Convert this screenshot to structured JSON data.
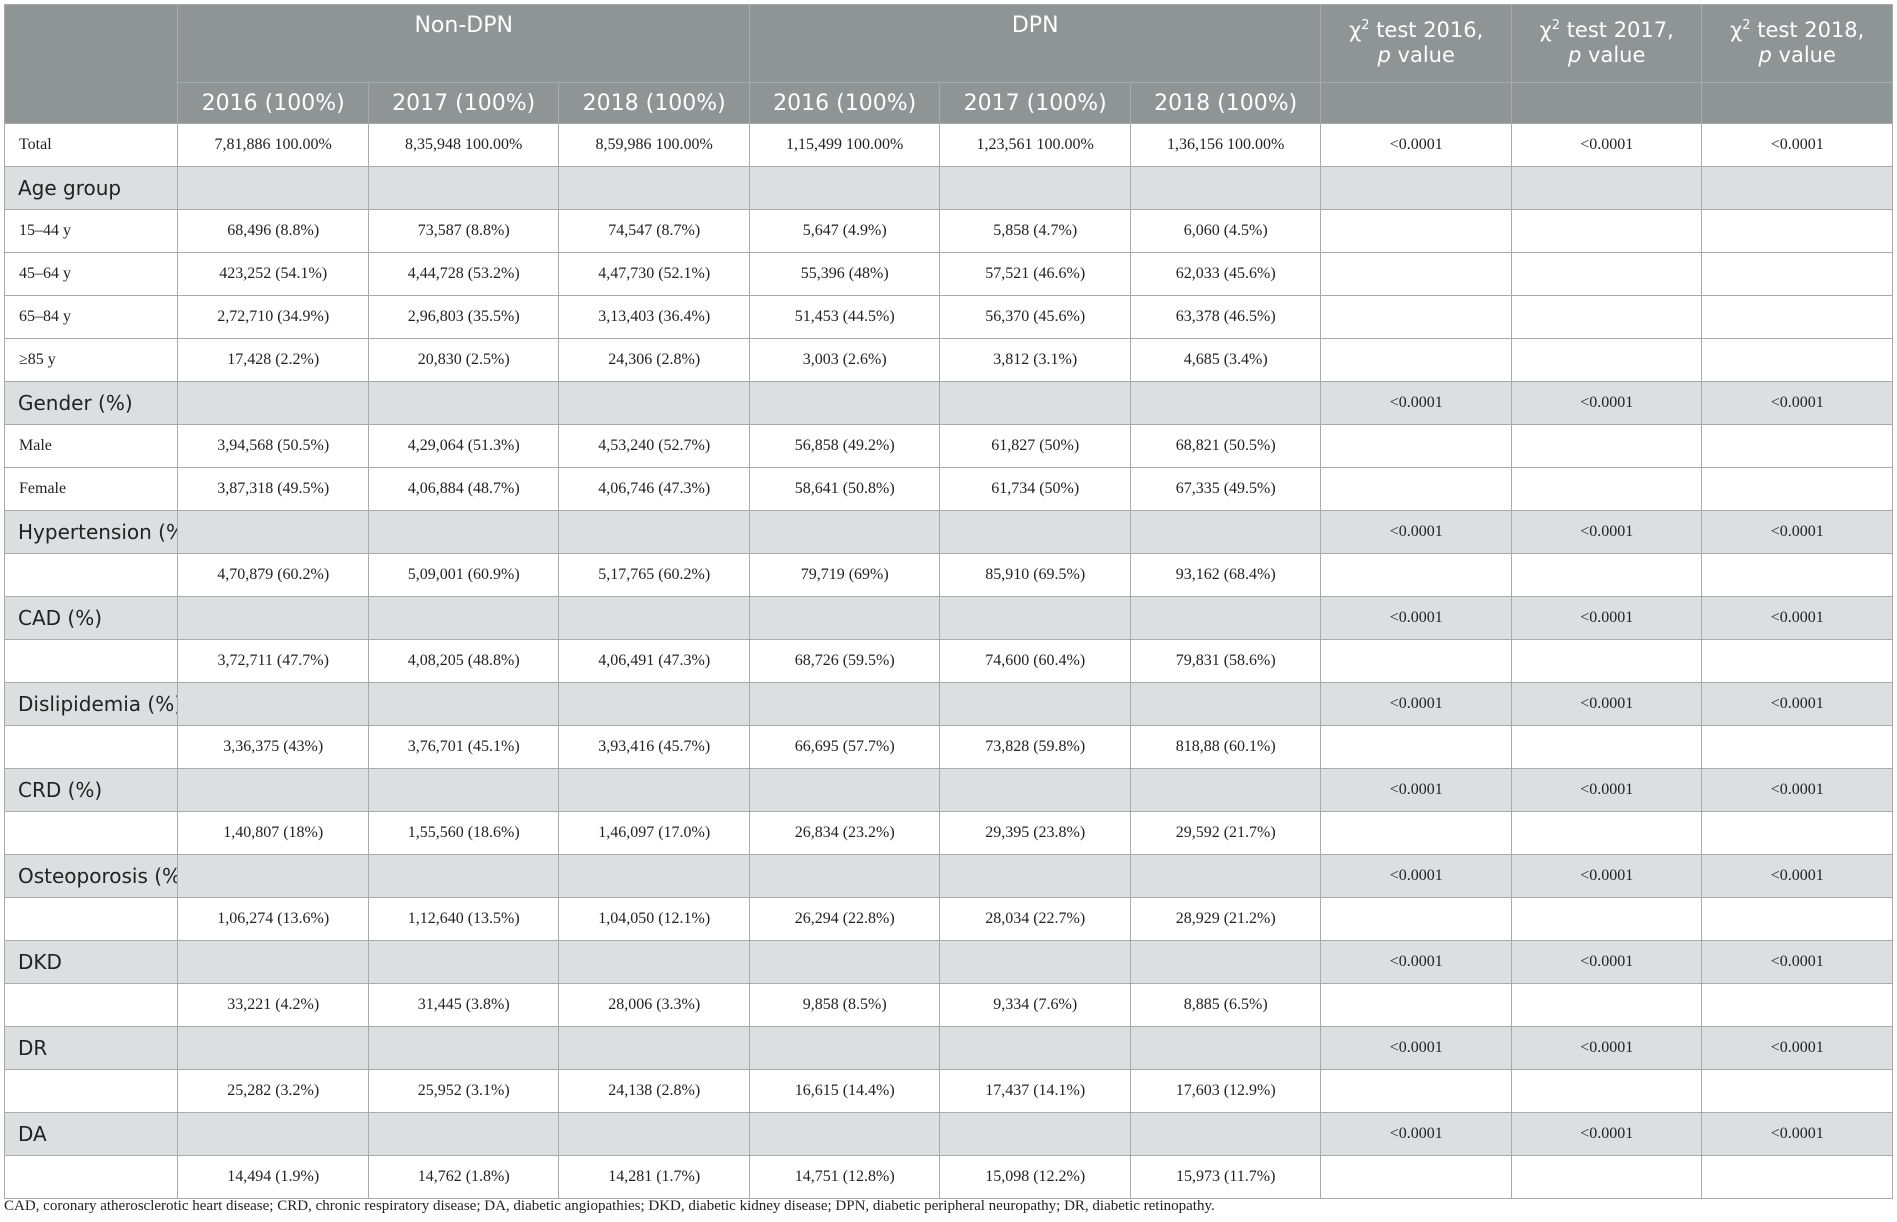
{
  "header": {
    "group_non_dpn": "Non-DPN",
    "group_dpn": "DPN",
    "chi_symbol": "χ",
    "chi_sup": "2",
    "pval_2016_a": "test 2016,",
    "pval_2017_a": "test 2017,",
    "pval_2018_a": "test 2018,",
    "pval_p": "p",
    "pval_value": "value",
    "years": [
      "2016 (100%)",
      "2017 (100%)",
      "2018 (100%)",
      "2016 (100%)",
      "2017 (100%)",
      "2018 (100%)"
    ]
  },
  "rows": [
    {
      "type": "data",
      "label": "Total",
      "cells": [
        "7,81,886 100.00%",
        "8,35,948 100.00%",
        "8,59,986 100.00%",
        "1,15,499 100.00%",
        "1,23,561 100.00%",
        "1,36,156 100.00%"
      ],
      "p": [
        "<0.0001",
        "<0.0001",
        "<0.0001"
      ]
    },
    {
      "type": "section",
      "label": "Age group",
      "p": [
        "",
        "",
        ""
      ]
    },
    {
      "type": "data",
      "label": "15–44 y",
      "cells": [
        "68,496 (8.8%)",
        "73,587 (8.8%)",
        "74,547 (8.7%)",
        "5,647 (4.9%)",
        "5,858 (4.7%)",
        "6,060 (4.5%)"
      ],
      "p": [
        "",
        "",
        ""
      ]
    },
    {
      "type": "data",
      "label": "45–64 y",
      "cells": [
        "423,252 (54.1%)",
        "4,44,728 (53.2%)",
        "4,47,730 (52.1%)",
        "55,396 (48%)",
        "57,521 (46.6%)",
        "62,033 (45.6%)"
      ],
      "p": [
        "",
        "",
        ""
      ]
    },
    {
      "type": "data",
      "label": "65–84 y",
      "cells": [
        "2,72,710 (34.9%)",
        "2,96,803 (35.5%)",
        "3,13,403 (36.4%)",
        "51,453 (44.5%)",
        "56,370 (45.6%)",
        "63,378 (46.5%)"
      ],
      "p": [
        "",
        "",
        ""
      ]
    },
    {
      "type": "data",
      "label": "≥85 y",
      "cells": [
        "17,428 (2.2%)",
        "20,830 (2.5%)",
        "24,306 (2.8%)",
        "3,003 (2.6%)",
        "3,812 (3.1%)",
        "4,685 (3.4%)"
      ],
      "p": [
        "",
        "",
        ""
      ]
    },
    {
      "type": "section",
      "label": "Gender (%)",
      "p": [
        "<0.0001",
        "<0.0001",
        "<0.0001"
      ]
    },
    {
      "type": "data",
      "label": "Male",
      "cells": [
        "3,94,568 (50.5%)",
        "4,29,064 (51.3%)",
        "4,53,240 (52.7%)",
        "56,858 (49.2%)",
        "61,827 (50%)",
        "68,821 (50.5%)"
      ],
      "p": [
        "",
        "",
        ""
      ]
    },
    {
      "type": "data",
      "label": "Female",
      "cells": [
        "3,87,318 (49.5%)",
        "4,06,884 (48.7%)",
        "4,06,746 (47.3%)",
        "58,641 (50.8%)",
        "61,734 (50%)",
        "67,335 (49.5%)"
      ],
      "p": [
        "",
        "",
        ""
      ]
    },
    {
      "type": "section",
      "label": "Hypertension (%)",
      "p": [
        "<0.0001",
        "<0.0001",
        "<0.0001"
      ]
    },
    {
      "type": "data",
      "label": "",
      "cells": [
        "4,70,879 (60.2%)",
        "5,09,001 (60.9%)",
        "5,17,765 (60.2%)",
        "79,719 (69%)",
        "85,910 (69.5%)",
        "93,162 (68.4%)"
      ],
      "p": [
        "",
        "",
        ""
      ]
    },
    {
      "type": "section",
      "label": "CAD (%)",
      "p": [
        "<0.0001",
        "<0.0001",
        "<0.0001"
      ]
    },
    {
      "type": "data",
      "label": "",
      "cells": [
        "3,72,711 (47.7%)",
        "4,08,205 (48.8%)",
        "4,06,491 (47.3%)",
        "68,726 (59.5%)",
        "74,600 (60.4%)",
        "79,831 (58.6%)"
      ],
      "p": [
        "",
        "",
        ""
      ]
    },
    {
      "type": "section",
      "label": "Dislipidemia (%)",
      "p": [
        "<0.0001",
        "<0.0001",
        "<0.0001"
      ]
    },
    {
      "type": "data",
      "label": "",
      "cells": [
        "3,36,375 (43%)",
        "3,76,701 (45.1%)",
        "3,93,416 (45.7%)",
        "66,695 (57.7%)",
        "73,828 (59.8%)",
        "818,88 (60.1%)"
      ],
      "p": [
        "",
        "",
        ""
      ]
    },
    {
      "type": "section",
      "label": "CRD (%)",
      "p": [
        "<0.0001",
        "<0.0001",
        "<0.0001"
      ]
    },
    {
      "type": "data",
      "label": "",
      "cells": [
        "1,40,807 (18%)",
        "1,55,560 (18.6%)",
        "1,46,097 (17.0%)",
        "26,834 (23.2%)",
        "29,395 (23.8%)",
        "29,592 (21.7%)"
      ],
      "p": [
        "",
        "",
        ""
      ]
    },
    {
      "type": "section",
      "label": "Osteoporosis (%)",
      "p": [
        "<0.0001",
        "<0.0001",
        "<0.0001"
      ]
    },
    {
      "type": "data",
      "label": "",
      "cells": [
        "1,06,274 (13.6%)",
        "1,12,640 (13.5%)",
        "1,04,050 (12.1%)",
        "26,294 (22.8%)",
        "28,034 (22.7%)",
        "28,929 (21.2%)"
      ],
      "p": [
        "",
        "",
        ""
      ]
    },
    {
      "type": "section",
      "label": "DKD",
      "p": [
        "<0.0001",
        "<0.0001",
        "<0.0001"
      ]
    },
    {
      "type": "data",
      "label": "",
      "cells": [
        "33,221 (4.2%)",
        "31,445 (3.8%)",
        "28,006 (3.3%)",
        "9,858 (8.5%)",
        "9,334 (7.6%)",
        "8,885 (6.5%)"
      ],
      "p": [
        "",
        "",
        ""
      ]
    },
    {
      "type": "section",
      "label": "DR",
      "p": [
        "<0.0001",
        "<0.0001",
        "<0.0001"
      ]
    },
    {
      "type": "data",
      "label": "",
      "cells": [
        "25,282 (3.2%)",
        "25,952 (3.1%)",
        "24,138 (2.8%)",
        "16,615 (14.4%)",
        "17,437 (14.1%)",
        "17,603 (12.9%)"
      ],
      "p": [
        "",
        "",
        ""
      ]
    },
    {
      "type": "section",
      "label": "DA",
      "p": [
        "<0.0001",
        "<0.0001",
        "<0.0001"
      ]
    },
    {
      "type": "data",
      "label": "",
      "cells": [
        "14,494 (1.9%)",
        "14,762 (1.8%)",
        "14,281 (1.7%)",
        "14,751 (12.8%)",
        "15,098 (12.2%)",
        "15,973 (11.7%)"
      ],
      "p": [
        "",
        "",
        ""
      ]
    }
  ],
  "footnote": "CAD, coronary atherosclerotic heart disease; CRD, chronic respiratory disease; DA, diabetic angiopathies; DKD, diabetic kidney disease; DPN, diabetic peripheral neuropathy; DR, diabetic retinopathy."
}
